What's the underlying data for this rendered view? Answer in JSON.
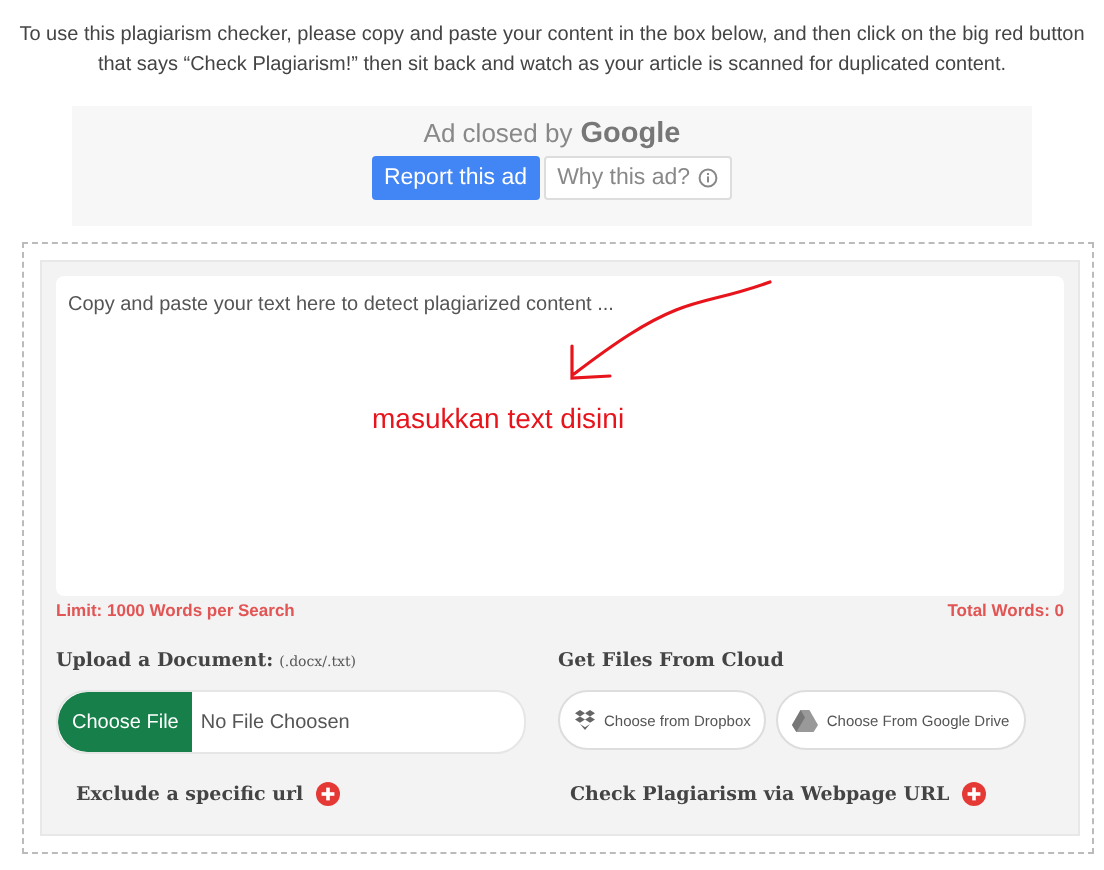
{
  "instructions": "To use this plagiarism checker, please copy and paste your content in the box below, and then click on the big red button that says “Check Plagiarism!” then sit back and watch as your article is scanned for duplicated content.",
  "ad": {
    "status": "Ad closed by",
    "brand": "Google",
    "buttons": [
      {
        "label": "Report this ad",
        "kind": "primary"
      },
      {
        "label": "Why this ad?",
        "kind": "info"
      }
    ]
  },
  "editor": {
    "placeholder": "Copy and paste your text here to detect plagiarized content ...",
    "annotation": "masukkan text disini",
    "limit": "Limit: 1000 Words per Search",
    "total": "Total Words: 0"
  },
  "upload": {
    "label": "Upload a Document:",
    "formats": "(.docx/.txt)",
    "button": "Choose File",
    "file_name": "No File Choosen"
  },
  "cloud": {
    "label": "Get Files From Cloud",
    "buttons": [
      {
        "label": "Choose from Dropbox",
        "kind": "dropbox"
      },
      {
        "label": "Choose From Google Drive",
        "kind": "drive"
      }
    ]
  },
  "options": [
    {
      "label": "Exclude a specific url"
    },
    {
      "label": "Check Plagiarism via Webpage URL"
    }
  ]
}
